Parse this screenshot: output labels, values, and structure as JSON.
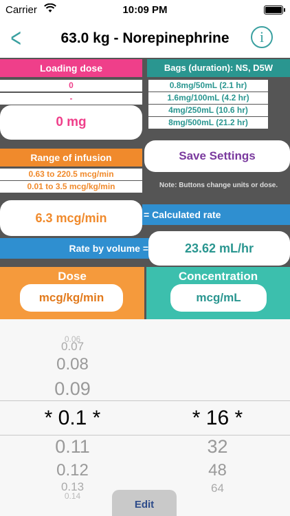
{
  "status": {
    "carrier": "Carrier",
    "time": "10:09 PM"
  },
  "nav": {
    "back": "<",
    "title": "63.0 kg - Norepinephrine",
    "info": "i"
  },
  "loading": {
    "header": "Loading dose",
    "row1": "0",
    "row2": "-",
    "button": "0 mg"
  },
  "bags": {
    "header": "Bags (duration): NS, D5W",
    "items": [
      "0.8mg/50mL (2.1 hr)",
      "1.6mg/100mL (4.2 hr)",
      "4mg/250mL (10.6 hr)",
      "8mg/500mL (21.2 hr)"
    ]
  },
  "range": {
    "header": "Range of infusion",
    "row1": "0.63 to 220.5 mcg/min",
    "row2": "0.01 to 3.5 mcg/kg/min"
  },
  "save": {
    "label": "Save Settings"
  },
  "note": "Note: Buttons change units or dose.",
  "calc": {
    "value": "6.3 mcg/min",
    "label": "= Calculated rate"
  },
  "volume": {
    "label": "Rate by volume =",
    "value": "23.62 mL/hr"
  },
  "dose": {
    "header": "Dose",
    "unit": "mcg/kg/min"
  },
  "concentration": {
    "header": "Concentration",
    "unit": "mcg/mL"
  },
  "picker": {
    "left": [
      "0.06",
      "0.07",
      "0.08",
      "0.09",
      "* 0.1 *",
      "0.11",
      "0.12",
      "0.13",
      "0.14"
    ],
    "right": [
      "* 16 *",
      "32",
      "48",
      "64"
    ]
  },
  "edit": "Edit",
  "colors": {
    "pink": "#ef3f8a",
    "teal": "#2a9690",
    "orange": "#f08a2c",
    "blue": "#2f8fd0",
    "green": "#3cbfad",
    "purple": "#7a3a9e"
  }
}
